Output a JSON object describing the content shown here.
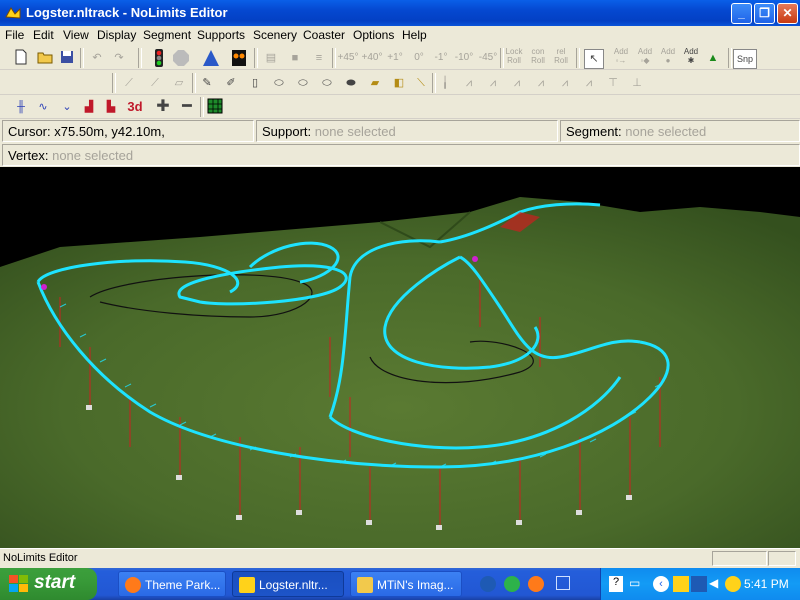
{
  "window": {
    "title": "Logster.nltrack - NoLimits Editor"
  },
  "menu": [
    "File",
    "Edit",
    "View",
    "Display",
    "Segment",
    "Supports",
    "Scenery",
    "Coaster",
    "Options",
    "Help"
  ],
  "toolbar1": {
    "elevations": [
      "+45°",
      "+40°",
      "+1°",
      "0°",
      "-1°",
      "-10°",
      "-45°"
    ],
    "lock_roll": "Lock\nRoll",
    "con_roll": "con\nRoll",
    "rel_roll": "rel\nRoll",
    "add_labels": [
      "Add",
      "Add",
      "Add",
      "Add"
    ],
    "snap": "Snp"
  },
  "toolbar3": {
    "mode_3d": "3d"
  },
  "info": {
    "cursor_label": "Cursor:",
    "cursor_value": "x75.50m, y42.10m,",
    "support_label": "Support:",
    "support_value": "none selected",
    "segment_label": "Segment:",
    "segment_value": "none selected",
    "vertex_label": "Vertex:",
    "vertex_value": "none selected"
  },
  "statusbar": {
    "text": "NoLimits Editor"
  },
  "taskbar": {
    "start": "start",
    "tasks": [
      "Theme Park...",
      "Logster.nltr...",
      "MTiN's Imag..."
    ],
    "clock": "5:41 PM"
  },
  "colors": {
    "track": "#1ee3ff",
    "terrain": "#4b6a2c",
    "support": "#cc2020",
    "titlebar": "#0548d0"
  }
}
